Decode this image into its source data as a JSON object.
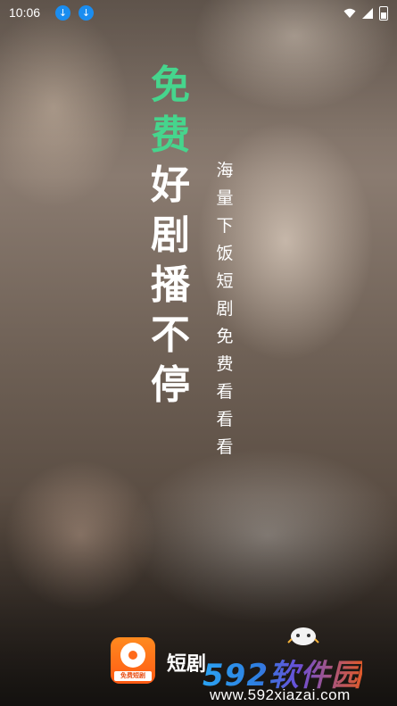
{
  "status_bar": {
    "time": "10:06",
    "icons": [
      "download-icon",
      "download-icon",
      "wifi-icon",
      "signal-icon",
      "battery-icon"
    ]
  },
  "headline": {
    "chars_green": [
      "免",
      "费"
    ],
    "chars_white": [
      "好",
      "剧",
      "播",
      "不",
      "停"
    ],
    "accent_color": "#46d58d"
  },
  "tagline": {
    "chars": [
      "海",
      "量",
      "下",
      "饭",
      "短",
      "剧",
      "免",
      "费",
      "看",
      "看",
      "看"
    ]
  },
  "branding": {
    "logo_label": "免费短剧",
    "app_name": "短剧"
  },
  "watermark": {
    "title": "592软件园",
    "url": "www.592xiazai.com"
  }
}
